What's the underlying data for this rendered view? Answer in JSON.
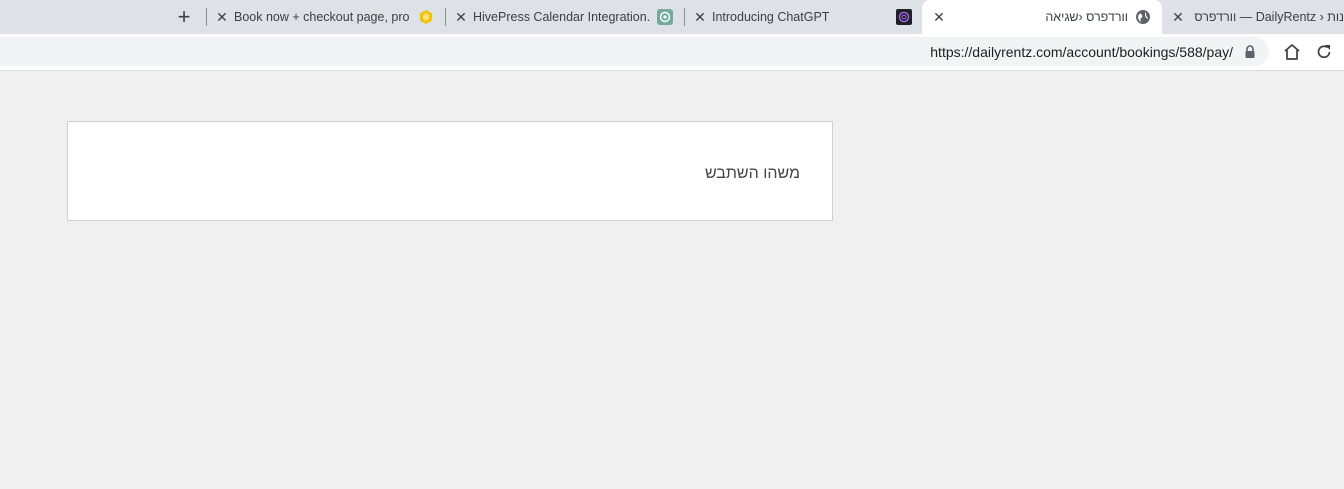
{
  "browser": {
    "new_tab_label": "+",
    "tabs": [
      {
        "title": "Book now + checkout page, prob",
        "favicon": "hivepress-icon",
        "close": "✕"
      },
      {
        "title": "HivePress Calendar Integration.",
        "favicon": "chatgpt-icon",
        "close": "✕"
      },
      {
        "title": "Introducing ChatGPT",
        "favicon": "openai-icon",
        "close": "✕"
      },
      {
        "title": "וורדפרס ‹שגיאה",
        "favicon": "globe-icon",
        "close": "✕",
        "active": true
      },
      {
        "title": "נות ‹ DailyRentz — וורדפרס",
        "close": "✕"
      }
    ],
    "url": "https://dailyrentz.com/account/bookings/588/pay/"
  },
  "page": {
    "error_message": "משהו השתבש"
  },
  "colors": {
    "tabstrip_bg": "#dee1e6",
    "page_bg": "#f0f0f0",
    "card_border": "#cfcfcf",
    "hivepress_yellow": "#f5c000",
    "chatgpt_green": "#74aa9c"
  }
}
